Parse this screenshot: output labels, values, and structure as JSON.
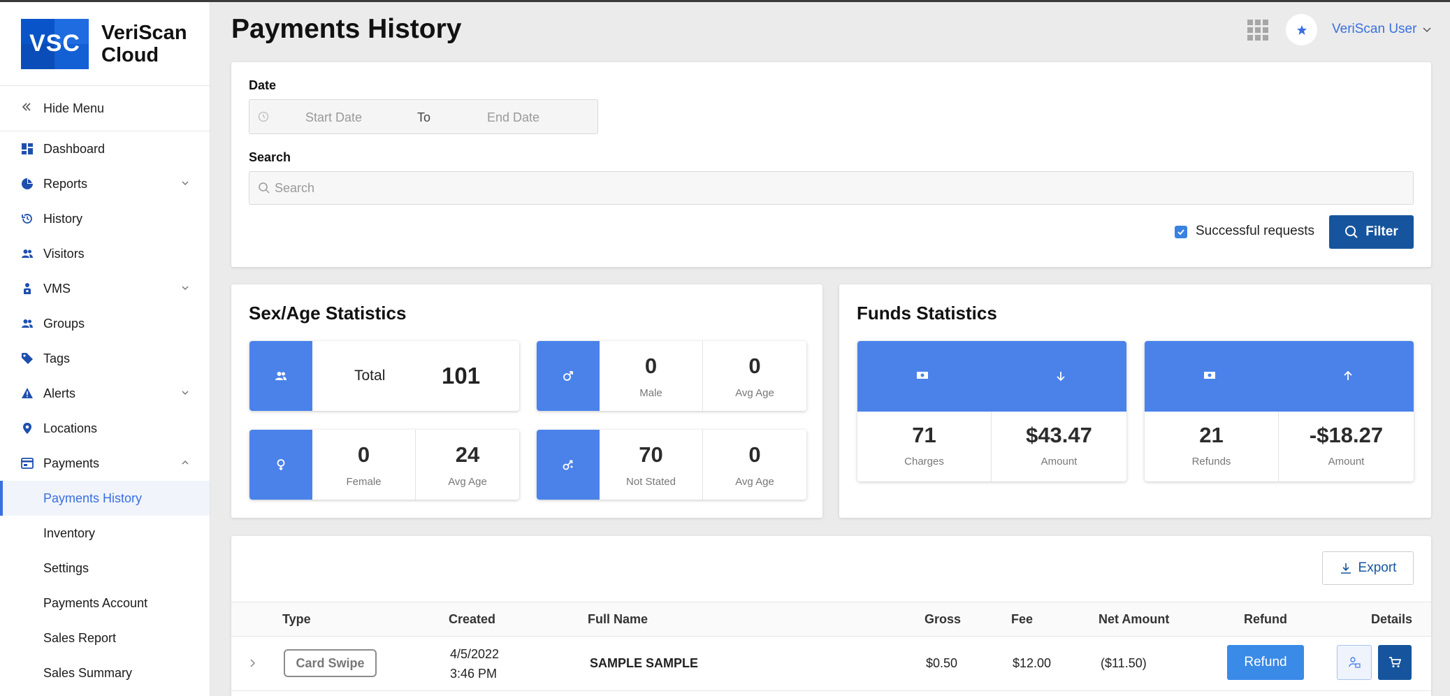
{
  "app": {
    "brand_line1": "VeriScan",
    "brand_line2": "Cloud",
    "logo_text": "VSC"
  },
  "sidebar": {
    "hide_menu": "Hide Menu",
    "items": [
      {
        "label": "Dashboard",
        "icon": "dashboard-icon"
      },
      {
        "label": "Reports",
        "icon": "pie-chart-icon",
        "expandable": true
      },
      {
        "label": "History",
        "icon": "history-icon"
      },
      {
        "label": "Visitors",
        "icon": "users-icon"
      },
      {
        "label": "VMS",
        "icon": "person-badge-icon",
        "expandable": true
      },
      {
        "label": "Groups",
        "icon": "group-icon"
      },
      {
        "label": "Tags",
        "icon": "tag-icon"
      },
      {
        "label": "Alerts",
        "icon": "warning-icon",
        "expandable": true
      },
      {
        "label": "Locations",
        "icon": "location-pin-icon"
      },
      {
        "label": "Payments",
        "icon": "payments-icon",
        "expanded": true
      }
    ],
    "sub_items": [
      "Payments History",
      "Inventory",
      "Settings",
      "Payments Account",
      "Sales Report",
      "Sales Summary"
    ],
    "active_sub_item": "Payments History"
  },
  "header": {
    "title": "Payments History",
    "user": "VeriScan User"
  },
  "filters": {
    "date_label": "Date",
    "start_placeholder": "Start Date",
    "to_label": "To",
    "end_placeholder": "End Date",
    "search_label": "Search",
    "search_placeholder": "Search",
    "successful_label": "Successful requests",
    "successful_checked": true,
    "filter_button": "Filter"
  },
  "sex_age": {
    "title": "Sex/Age Statistics",
    "total_label": "Total",
    "total": "101",
    "male": {
      "count": "0",
      "label": "Male",
      "avg_age": "0",
      "avg_label": "Avg Age"
    },
    "female": {
      "count": "0",
      "label": "Female",
      "avg_age": "24",
      "avg_label": "Avg Age"
    },
    "not_stated": {
      "count": "70",
      "label": "Not Stated",
      "avg_age": "0",
      "avg_label": "Avg Age"
    }
  },
  "funds": {
    "title": "Funds Statistics",
    "charges": {
      "count": "71",
      "label": "Charges",
      "amount": "$43.47",
      "amount_label": "Amount"
    },
    "refunds": {
      "count": "21",
      "label": "Refunds",
      "amount": "-$18.27",
      "amount_label": "Amount"
    }
  },
  "table": {
    "export_label": "Export",
    "columns": [
      "Type",
      "Created",
      "Full Name",
      "Gross",
      "Fee",
      "Net Amount",
      "Refund",
      "Details"
    ],
    "rows": [
      {
        "type": "Card Swipe",
        "created_date": "4/5/2022",
        "created_time": "3:46 PM",
        "full_name": "SAMPLE SAMPLE",
        "gross": "$0.50",
        "fee": "$12.00",
        "net": "($11.50)",
        "refund_label": "Refund"
      }
    ]
  },
  "colors": {
    "accent": "#4a82ea",
    "primary": "#16559d",
    "link": "#3a6fe0"
  }
}
